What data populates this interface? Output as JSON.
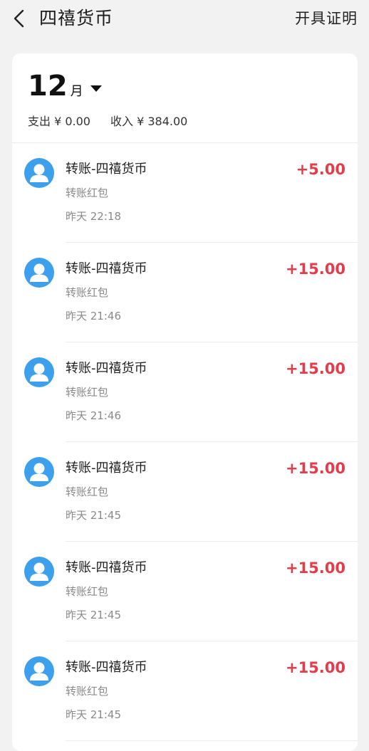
{
  "header": {
    "title": "四禧货币",
    "action_label": "开具证明"
  },
  "filter": {
    "month": "12",
    "month_unit": "月"
  },
  "summary": {
    "expense": "支出 ¥ 0.00",
    "income": "收入 ¥ 384.00"
  },
  "transactions": [
    {
      "name": "转账-四禧货币",
      "type": "转账红包",
      "time": "昨天 22:18",
      "amount": "+5.00"
    },
    {
      "name": "转账-四禧货币",
      "type": "转账红包",
      "time": "昨天 21:46",
      "amount": "+15.00"
    },
    {
      "name": "转账-四禧货币",
      "type": "转账红包",
      "time": "昨天 21:46",
      "amount": "+15.00"
    },
    {
      "name": "转账-四禧货币",
      "type": "转账红包",
      "time": "昨天 21:45",
      "amount": "+15.00"
    },
    {
      "name": "转账-四禧货币",
      "type": "转账红包",
      "time": "昨天 21:45",
      "amount": "+15.00"
    },
    {
      "name": "转账-四禧货币",
      "type": "转账红包",
      "time": "昨天 21:45",
      "amount": "+15.00"
    }
  ],
  "icons": {
    "back": "chevron-left-icon",
    "avatar": "user-avatar-icon",
    "dropdown": "caret-down-icon"
  },
  "colors": {
    "amount_positive": "#e53c4b",
    "avatar_bg": "#3da0ec",
    "page_bg": "#f2f2f2"
  }
}
